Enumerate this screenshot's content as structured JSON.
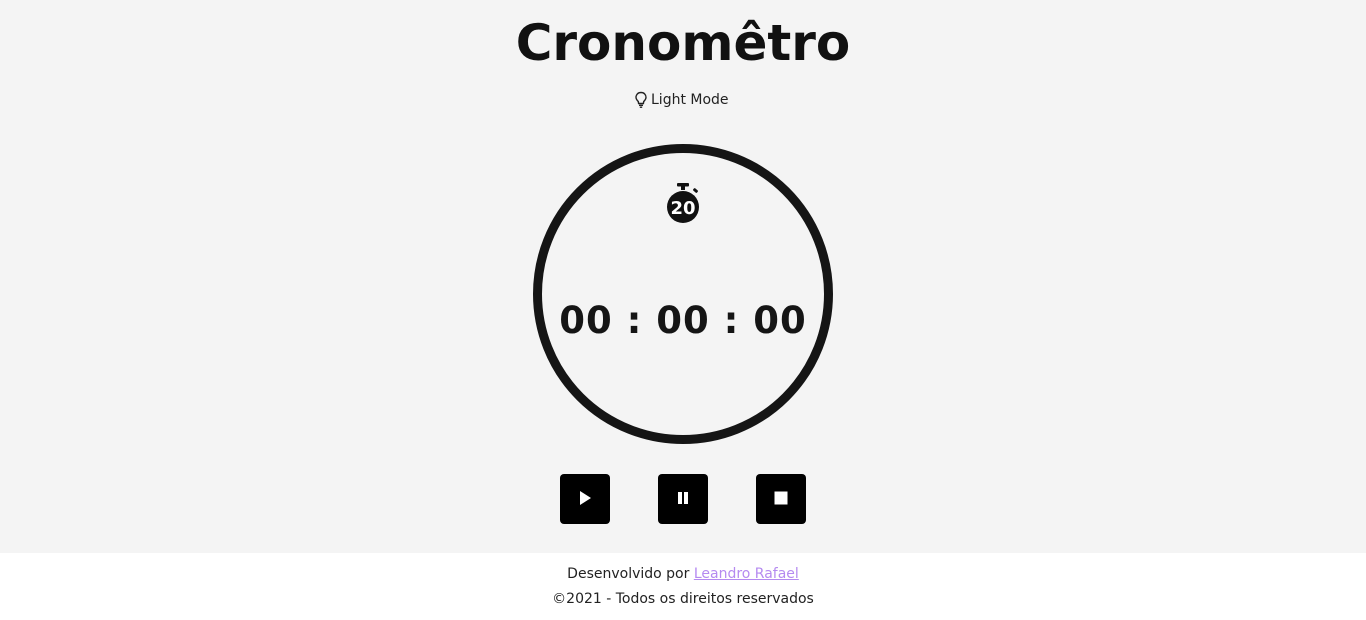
{
  "header": {
    "title": "Cronomêtro",
    "mode_label": "Light Mode",
    "mode_icon": "lightbulb-icon"
  },
  "timer": {
    "icon": "stopwatch-20-icon",
    "icon_number": "20",
    "display": "00 : 00 : 00"
  },
  "controls": {
    "play_icon": "play-icon",
    "pause_icon": "pause-icon",
    "stop_icon": "stop-icon"
  },
  "footer": {
    "developed_by": "Desenvolvido por",
    "author": "Leandro Rafael",
    "copyright": "©2021 - Todos os direitos reservados"
  },
  "colors": {
    "background": "#f4f4f4",
    "footer_bg": "#ffffff",
    "ring": "#151515",
    "button": "#000000",
    "link": "#b58af0"
  }
}
